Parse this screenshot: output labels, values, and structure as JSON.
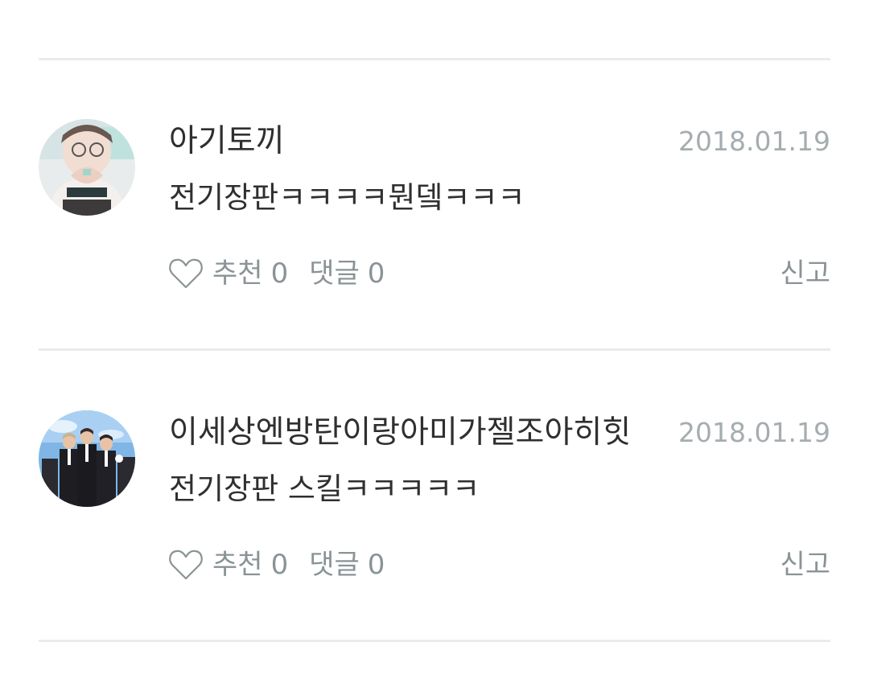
{
  "comments": [
    {
      "username": "아기토끼",
      "date": "2018.01.19",
      "text": "전기장판ㅋㅋㅋㅋ뭔뎈ㅋㅋㅋ",
      "like_label": "추천",
      "like_count": "0",
      "reply_label": "댓글",
      "reply_count": "0",
      "report_label": "신고"
    },
    {
      "username": "이세상엔방탄이랑아미가젤조아히힛",
      "date": "2018.01.19",
      "text": "전기장판 스킬ㅋㅋㅋㅋㅋ",
      "like_label": "추천",
      "like_count": "0",
      "reply_label": "댓글",
      "reply_count": "0",
      "report_label": "신고"
    }
  ],
  "icons": {
    "like": "heart-outline-icon"
  },
  "colors": {
    "text_primary": "#2f2f2f",
    "text_secondary": "#8a9396",
    "date": "#a6adb0",
    "divider": "#e9ecea"
  }
}
